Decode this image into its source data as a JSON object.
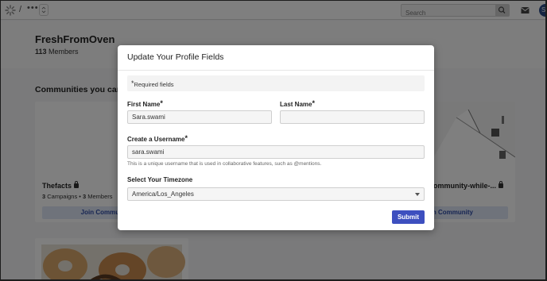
{
  "topbar": {
    "breadcrumb_sep": "/",
    "breadcrumb_more": "•••",
    "search_placeholder": "Search",
    "avatar_initial": "S"
  },
  "community": {
    "name": "FreshFromOven",
    "member_count": "113",
    "member_label": "Members"
  },
  "communities_section": {
    "title": "Communities you can Join",
    "cards": [
      {
        "title": "Thefacts",
        "campaigns": "3",
        "campaigns_label": "Campaigns",
        "members": "3",
        "members_label": "Members",
        "join_label": "Join Community"
      },
      {
        "title": "-community-while-...",
        "join_label": "Join Community"
      }
    ]
  },
  "modal": {
    "title": "Update Your Profile Fields",
    "required_note": "Required fields",
    "first_name_label": "First Name",
    "first_name_value": "Sara.swami",
    "last_name_label": "Last Name",
    "last_name_value": "",
    "username_label": "Create a Username",
    "username_value": "sara.swami",
    "username_hint": "This is a unique username that is used in collaborative features, such as @mentions.",
    "timezone_label": "Select Your Timezone",
    "timezone_value": "America/Los_Angeles",
    "submit_label": "Submit",
    "required_marker": "*"
  },
  "colors": {
    "primary_button": "#3d4fbf",
    "join_button_bg": "#dfe6f7",
    "join_button_text": "#2d4ba6",
    "overlay": "rgba(0,0,0,0.5)"
  }
}
